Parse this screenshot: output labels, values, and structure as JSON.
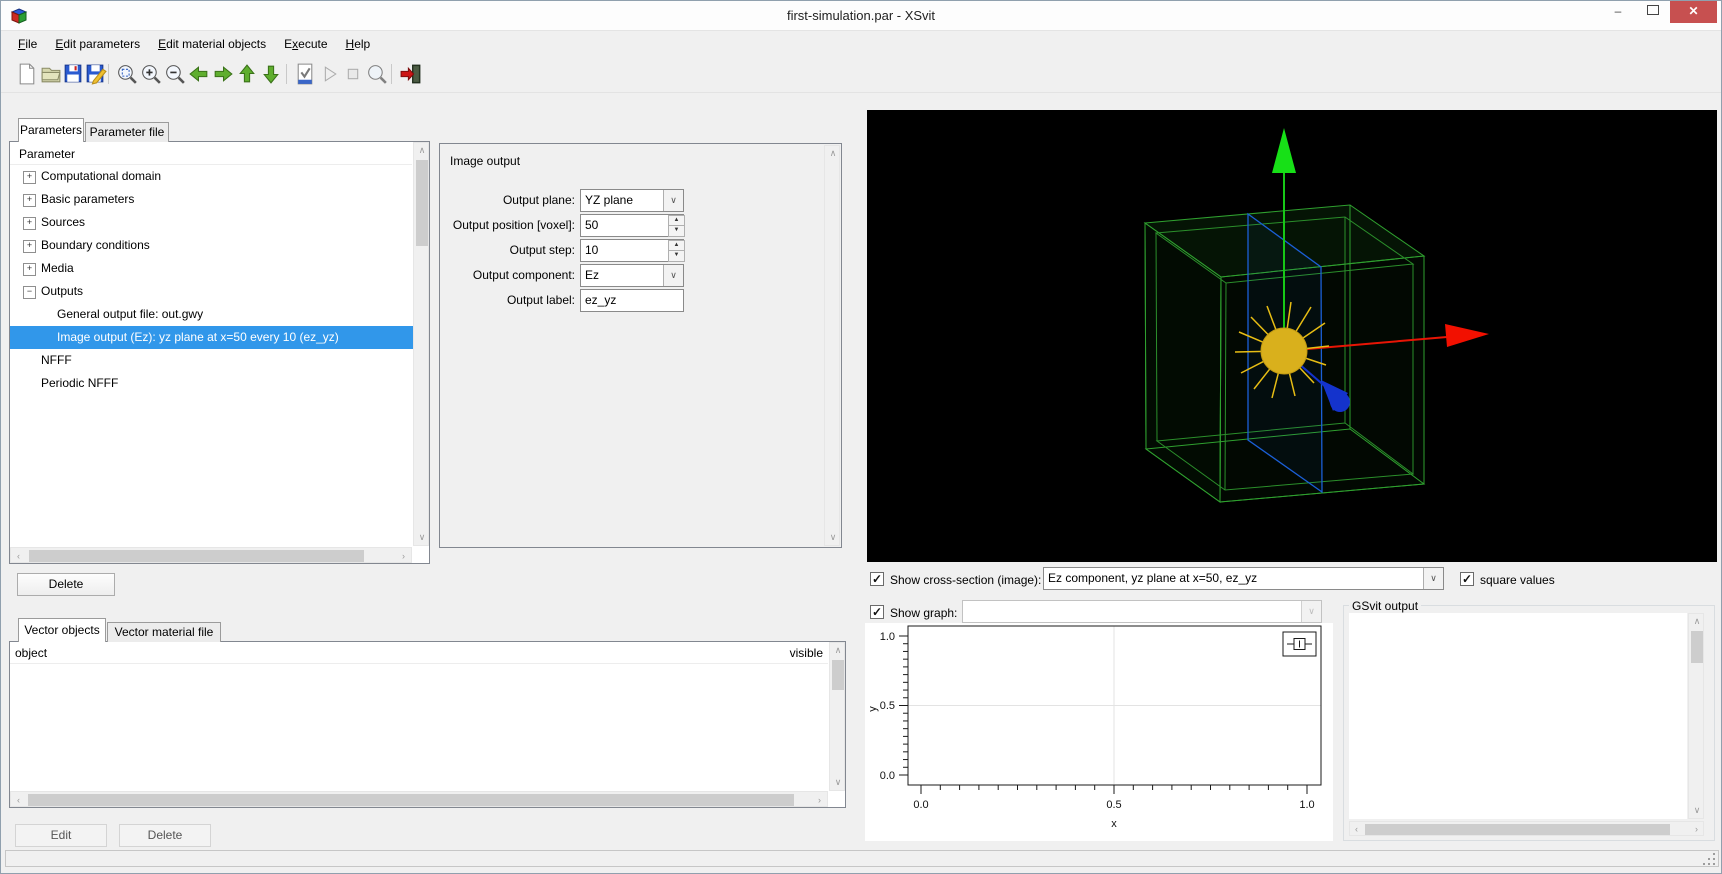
{
  "window": {
    "title": "first-simulation.par - XSvit",
    "app_icon": "gsvit-cube-icon",
    "controls": {
      "minimize": "–",
      "maximize": "",
      "close": "✕"
    }
  },
  "menu": {
    "items": [
      {
        "pre": "",
        "u": "F",
        "post": "ile"
      },
      {
        "pre": "",
        "u": "E",
        "post": "dit parameters"
      },
      {
        "pre": "",
        "u": "E",
        "post": "dit material objects"
      },
      {
        "pre": "E",
        "u": "x",
        "post": "ecute"
      },
      {
        "pre": "",
        "u": "H",
        "post": "elp"
      }
    ]
  },
  "toolbar": {
    "icons": [
      "new-file",
      "open-file",
      "save",
      "save-as",
      "zoom-fit",
      "zoom-in",
      "zoom-out",
      "nav-left",
      "nav-right",
      "nav-up",
      "nav-down",
      "check-parameters",
      "run",
      "stop",
      "inspect",
      "quit"
    ]
  },
  "left": {
    "tabs": {
      "parameters": "Parameters",
      "parameter_file": "Parameter file"
    },
    "tree": {
      "header": "Parameter",
      "items": [
        {
          "label": "Computational domain",
          "expander": "+",
          "level": 0,
          "selected": false
        },
        {
          "label": "Basic parameters",
          "expander": "+",
          "level": 0,
          "selected": false
        },
        {
          "label": "Sources",
          "expander": "+",
          "level": 0,
          "selected": false
        },
        {
          "label": "Boundary conditions",
          "expander": "+",
          "level": 0,
          "selected": false
        },
        {
          "label": "Media",
          "expander": "+",
          "level": 0,
          "selected": false
        },
        {
          "label": "Outputs",
          "expander": "−",
          "level": 0,
          "selected": false
        },
        {
          "label": "General output file: out.gwy",
          "expander": "",
          "level": 1,
          "selected": false
        },
        {
          "label": "Image output (Ez): yz plane at x=50 every 10 (ez_yz)",
          "expander": "",
          "level": 1,
          "selected": true
        },
        {
          "label": "NFFF",
          "expander": "",
          "level": 0,
          "selected": false
        },
        {
          "label": "Periodic NFFF",
          "expander": "",
          "level": 0,
          "selected": false
        }
      ]
    },
    "form": {
      "title": "Image output",
      "fields": [
        {
          "label": "Output plane:",
          "type": "combo",
          "value": "YZ plane"
        },
        {
          "label": "Output position [voxel]:",
          "type": "spin",
          "value": "50"
        },
        {
          "label": "Output step:",
          "type": "spin",
          "value": "10"
        },
        {
          "label": "Output component:",
          "type": "combo",
          "value": "Ez"
        },
        {
          "label": "Output label:",
          "type": "text",
          "value": "ez_yz"
        }
      ]
    },
    "delete_button": "Delete",
    "vector_tabs": {
      "objects": "Vector objects",
      "material_file": "Vector material file"
    },
    "vector_list": {
      "col_object": "object",
      "col_visible": "visible"
    },
    "edit_button": "Edit",
    "delete_button2": "Delete"
  },
  "right": {
    "cross_section": {
      "checked": true,
      "label": "Show cross-section (image):",
      "value": "Ez component, yz plane at x=50, ez_yz"
    },
    "square_values": {
      "checked": true,
      "label": "square values"
    },
    "show_graph": {
      "checked": true,
      "label": "Show graph:",
      "value": ""
    },
    "gsvit_output": {
      "label": "GSvit output",
      "content": ""
    },
    "viewport": {
      "objects": [
        "simulation-domain-wireframe",
        "inner-boundary-wireframe",
        "cross-section-plane",
        "point-source",
        "z-axis-arrow",
        "x-axis-arrow",
        "y-axis-arrow"
      ]
    }
  },
  "graph": {
    "xlabel": "x",
    "ylabel": "y",
    "xticks": [
      "0.0",
      "0.5",
      "1.0"
    ],
    "yticks": [
      "1.0",
      "0.5",
      "0.0"
    ],
    "series": []
  },
  "status": {
    "text": ""
  },
  "colors": {
    "selection_blue": "#3197ea",
    "close_red": "#c75050",
    "viewport_bg": "#000000",
    "cube_green": "#2fa02f",
    "plane_blue": "#1b5fd6",
    "source_yellow": "#d9b01c",
    "axis_z_green": "#17c817",
    "axis_x_red": "#e81505",
    "axis_y_blue": "#1433cc",
    "window_bg": "#f0f0f0"
  }
}
